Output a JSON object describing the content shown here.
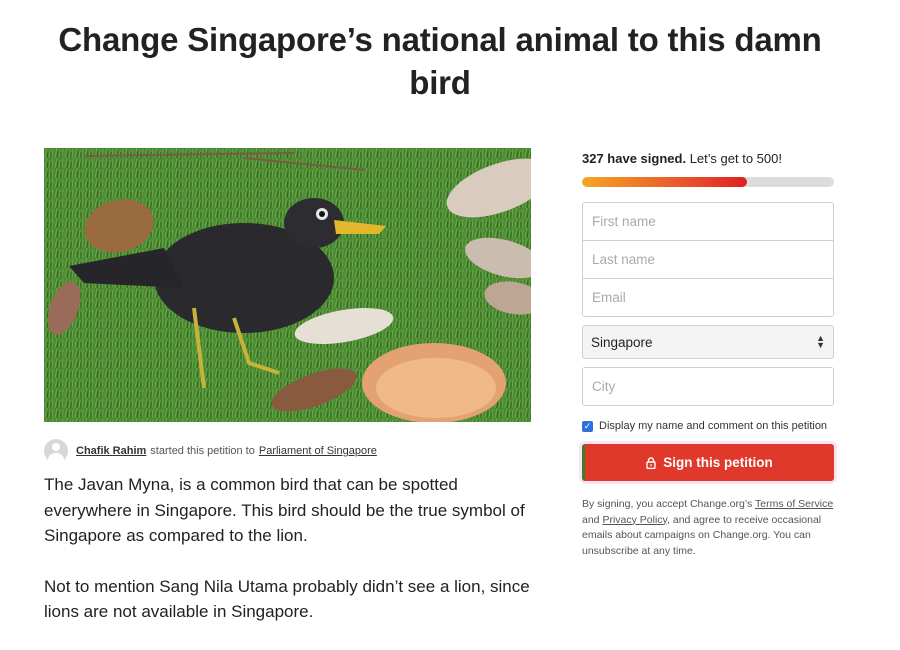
{
  "petition": {
    "title": "Change Singapore’s national animal to this damn bird",
    "image_alt": "Javan Myna bird on grass"
  },
  "starter": {
    "name": "Chafik Rahim",
    "middle": "started this petition to",
    "target": "Parliament of Singapore"
  },
  "story": {
    "paragraphs": [
      "The Javan Myna, is a common bird that can be spotted everywhere in Singapore. This bird should be the true symbol of Singapore as compared to the lion.",
      "Not to mention Sang Nila Utama probably didn’t see a lion, since lions are not available in Singapore."
    ]
  },
  "signatures": {
    "count_text": "327 have signed.",
    "goal_text": "Let’s get to 500!",
    "signed": 327,
    "goal": 500
  },
  "form": {
    "first_name_placeholder": "First name",
    "last_name_placeholder": "Last name",
    "email_placeholder": "Email",
    "country_value": "Singapore",
    "city_placeholder": "City",
    "display_checkbox_label": "Display my name and comment on this petition",
    "display_checked": true,
    "sign_button_label": "Sign this petition"
  },
  "legal": {
    "t1": "By signing, you accept Change.org’s",
    "terms": "Terms of Service",
    "t2": "and",
    "privacy": "Privacy Policy",
    "t3": ", and agree to receive occasional emails about campaigns on Change.org. You can unsubscribe at any time."
  },
  "colors": {
    "sign_button": "#e0392b",
    "progress_start": "#f5a623",
    "progress_end": "#de1f1f",
    "checkbox": "#2f6fe0"
  },
  "icons": {
    "lock": "lock-icon",
    "select_arrows": "up-down-arrows-icon",
    "avatar": "user-avatar-icon"
  }
}
